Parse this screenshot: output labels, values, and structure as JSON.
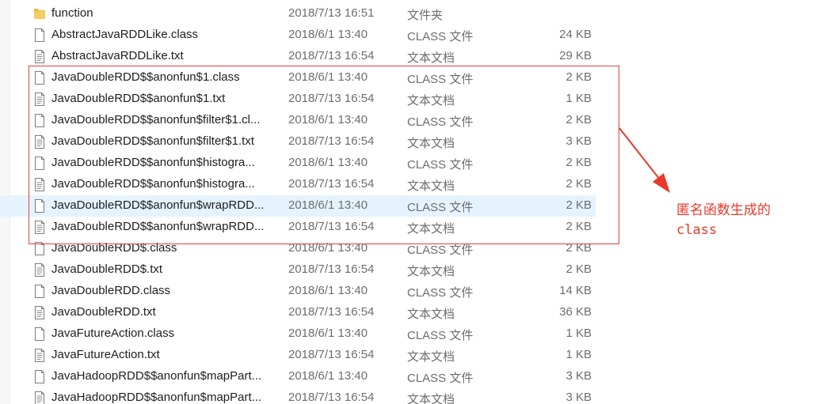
{
  "files": [
    {
      "name": "function",
      "date": "2018/7/13 16:51",
      "type": "文件夹",
      "size": "",
      "icon": "folder-icon"
    },
    {
      "name": "AbstractJavaRDDLike.class",
      "date": "2018/6/1 13:40",
      "type": "CLASS 文件",
      "size": "24 KB",
      "icon": "file-icon"
    },
    {
      "name": "AbstractJavaRDDLike.txt",
      "date": "2018/7/13 16:54",
      "type": "文本文档",
      "size": "29 KB",
      "icon": "text-file-icon"
    },
    {
      "name": "JavaDoubleRDD$$anonfun$1.class",
      "date": "2018/6/1 13:40",
      "type": "CLASS 文件",
      "size": "2 KB",
      "icon": "file-icon"
    },
    {
      "name": "JavaDoubleRDD$$anonfun$1.txt",
      "date": "2018/7/13 16:54",
      "type": "文本文档",
      "size": "1 KB",
      "icon": "text-file-icon"
    },
    {
      "name": "JavaDoubleRDD$$anonfun$filter$1.cl...",
      "date": "2018/6/1 13:40",
      "type": "CLASS 文件",
      "size": "2 KB",
      "icon": "file-icon"
    },
    {
      "name": "JavaDoubleRDD$$anonfun$filter$1.txt",
      "date": "2018/7/13 16:54",
      "type": "文本文档",
      "size": "3 KB",
      "icon": "text-file-icon"
    },
    {
      "name": "JavaDoubleRDD$$anonfun$histogra...",
      "date": "2018/6/1 13:40",
      "type": "CLASS 文件",
      "size": "2 KB",
      "icon": "file-icon"
    },
    {
      "name": "JavaDoubleRDD$$anonfun$histogra...",
      "date": "2018/7/13 16:54",
      "type": "文本文档",
      "size": "2 KB",
      "icon": "text-file-icon"
    },
    {
      "name": "JavaDoubleRDD$$anonfun$wrapRDD...",
      "date": "2018/6/1 13:40",
      "type": "CLASS 文件",
      "size": "2 KB",
      "icon": "file-icon",
      "hovered": true
    },
    {
      "name": "JavaDoubleRDD$$anonfun$wrapRDD...",
      "date": "2018/7/13 16:54",
      "type": "文本文档",
      "size": "2 KB",
      "icon": "text-file-icon"
    },
    {
      "name": "JavaDoubleRDD$.class",
      "date": "2018/6/1 13:40",
      "type": "CLASS 文件",
      "size": "2 KB",
      "icon": "file-icon"
    },
    {
      "name": "JavaDoubleRDD$.txt",
      "date": "2018/7/13 16:54",
      "type": "文本文档",
      "size": "2 KB",
      "icon": "text-file-icon"
    },
    {
      "name": "JavaDoubleRDD.class",
      "date": "2018/6/1 13:40",
      "type": "CLASS 文件",
      "size": "14 KB",
      "icon": "file-icon"
    },
    {
      "name": "JavaDoubleRDD.txt",
      "date": "2018/7/13 16:54",
      "type": "文本文档",
      "size": "36 KB",
      "icon": "text-file-icon"
    },
    {
      "name": "JavaFutureAction.class",
      "date": "2018/6/1 13:40",
      "type": "CLASS 文件",
      "size": "1 KB",
      "icon": "file-icon"
    },
    {
      "name": "JavaFutureAction.txt",
      "date": "2018/7/13 16:54",
      "type": "文本文档",
      "size": "1 KB",
      "icon": "text-file-icon"
    },
    {
      "name": "JavaHadoopRDD$$anonfun$mapPart...",
      "date": "2018/6/1 13:40",
      "type": "CLASS 文件",
      "size": "3 KB",
      "icon": "file-icon"
    },
    {
      "name": "JavaHadoopRDD$$anonfun$mapPart...",
      "date": "2018/7/13 16:54",
      "type": "文本文档",
      "size": "3 KB",
      "icon": "text-file-icon"
    }
  ],
  "annotation": {
    "line1": "匿名函数生成的",
    "line2": "class",
    "color": "#e8392a"
  },
  "colors": {
    "hover_row": "#e5f3ff",
    "folder": "#e8b84a",
    "highlight_box": "#e0423f"
  }
}
